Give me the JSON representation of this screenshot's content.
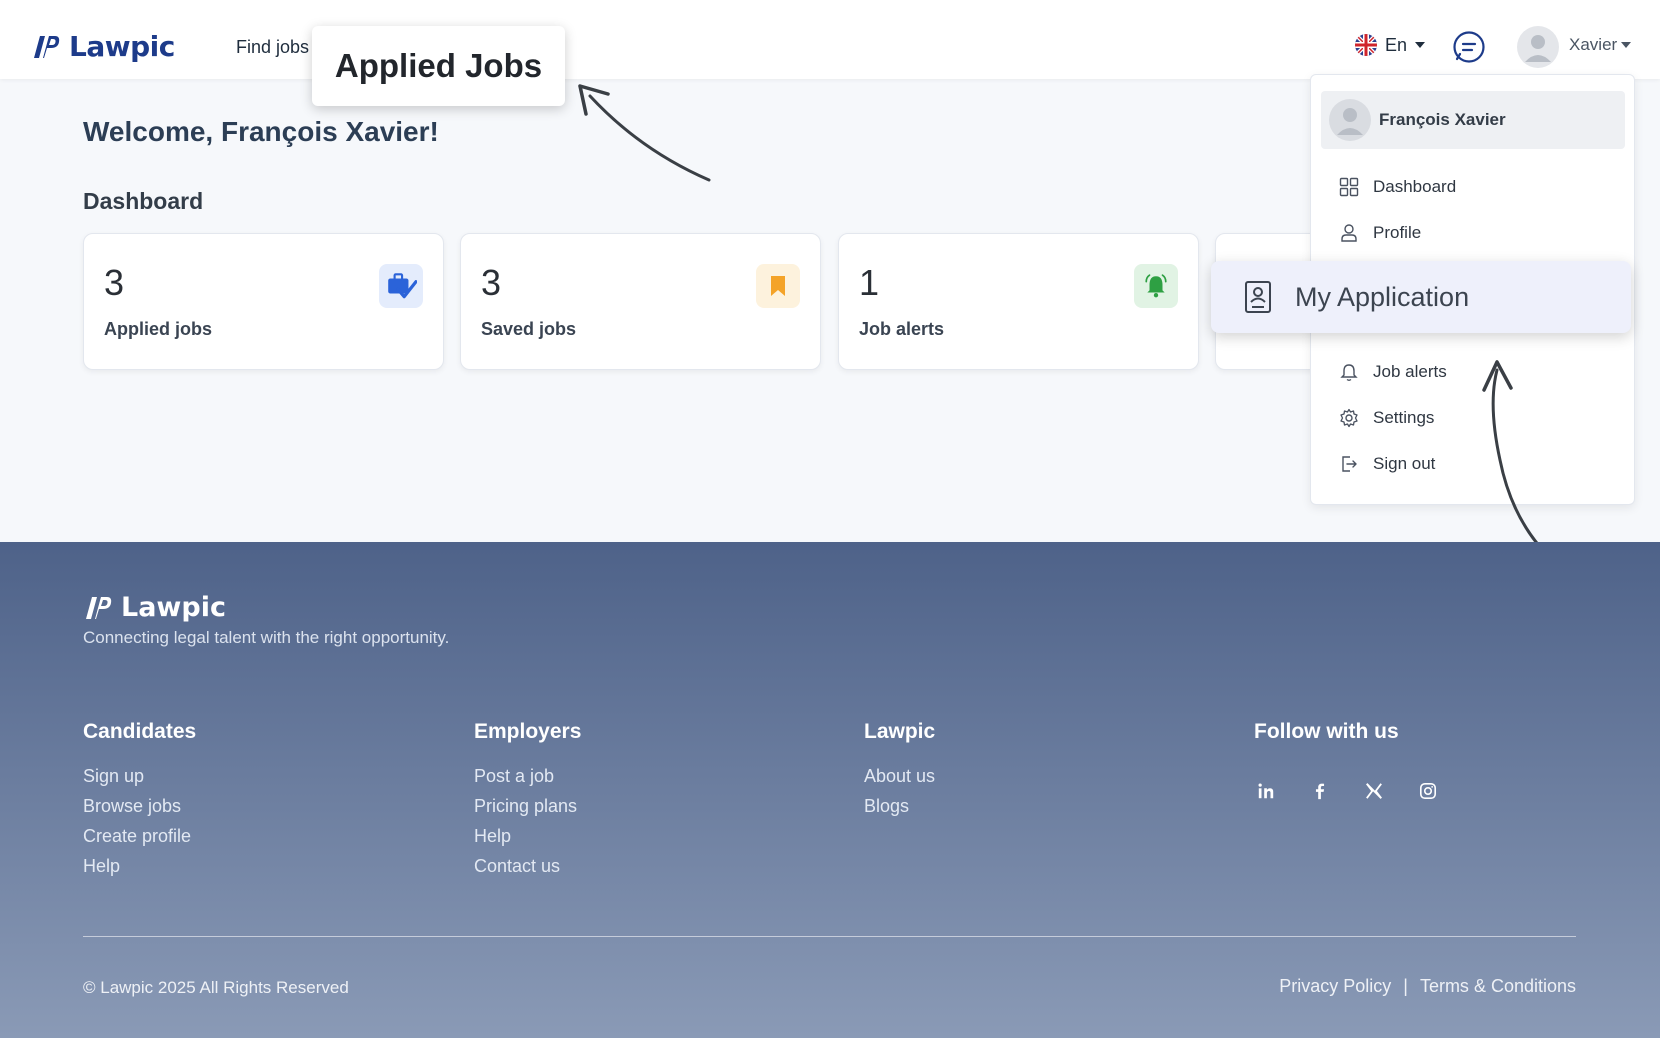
{
  "header": {
    "brand": "Lawpic",
    "nav_find_jobs": "Find jobs",
    "language": "En",
    "username": "Xavier"
  },
  "callout": {
    "text": "Applied Jobs"
  },
  "main": {
    "welcome": "Welcome, François Xavier!",
    "dashboard_title": "Dashboard",
    "cards": [
      {
        "value": "3",
        "label": "Applied jobs",
        "icon": "briefcase-check-icon",
        "color": "#2b63d9",
        "bg": "#e4ecfc"
      },
      {
        "value": "3",
        "label": "Saved jobs",
        "icon": "bookmark-icon",
        "color": "#f4a328",
        "bg": "#fdf2dd"
      },
      {
        "value": "1",
        "label": "Job alerts",
        "icon": "bell-icon",
        "color": "#2ea043",
        "bg": "#e1f3e4"
      }
    ]
  },
  "dropdown": {
    "user_name": "François Xavier",
    "items": {
      "dashboard": "Dashboard",
      "profile": "Profile",
      "job_alerts": "Job alerts",
      "settings": "Settings",
      "sign_out": "Sign out"
    },
    "highlighted": "My Application"
  },
  "footer": {
    "brand": "Lawpic",
    "tagline": "Connecting legal talent with the right opportunity.",
    "columns": [
      {
        "title": "Candidates",
        "links": [
          "Sign up",
          "Browse jobs",
          "Create profile",
          "Help"
        ]
      },
      {
        "title": "Employers",
        "links": [
          "Post a job",
          "Pricing plans",
          "Help",
          "Contact us"
        ]
      },
      {
        "title": "Lawpic",
        "links": [
          "About us",
          "Blogs"
        ]
      },
      {
        "title": "Follow with us",
        "links": []
      }
    ],
    "copyright": "© Lawpic 2025 All Rights Reserved",
    "privacy": "Privacy Policy",
    "separator": "|",
    "terms": "Terms & Conditions"
  }
}
